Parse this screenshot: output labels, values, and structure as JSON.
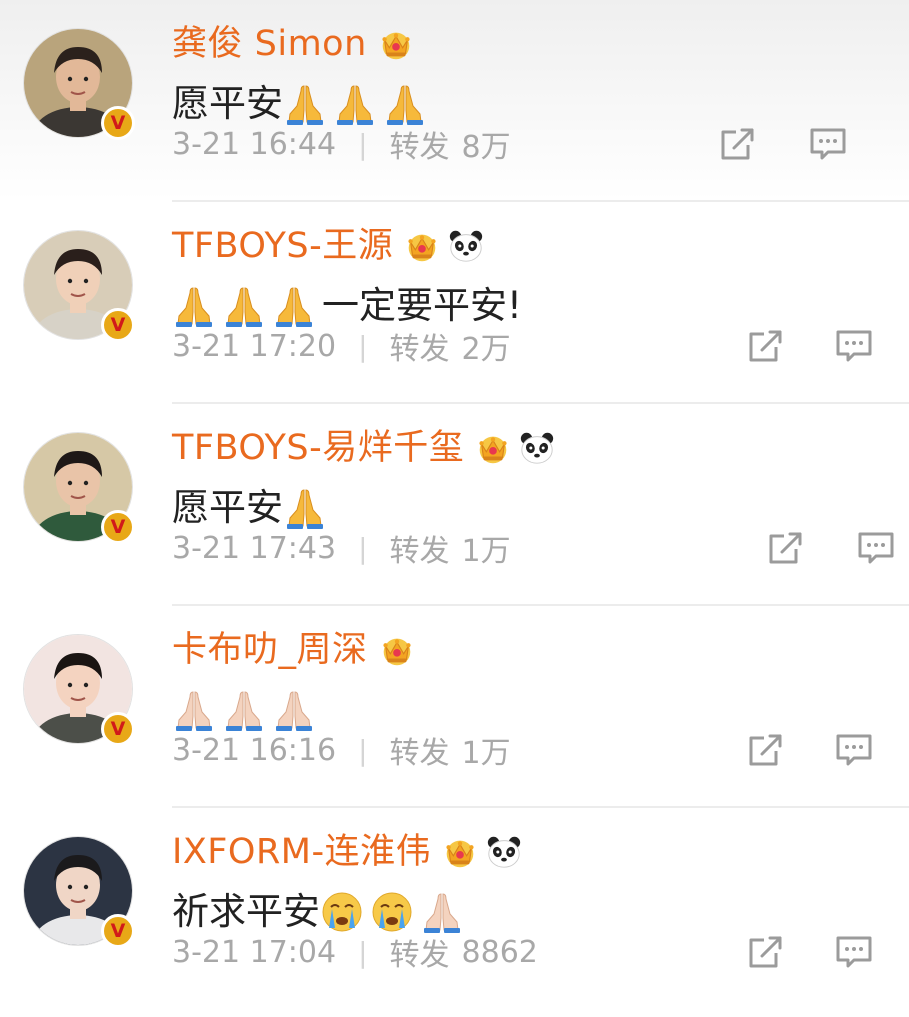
{
  "posts": [
    {
      "name": "龚俊 Simon",
      "badges": [
        "crown-icon"
      ],
      "content_text": "愿平安",
      "emoji_before": [],
      "emoji_after": [
        "folded-hands-icon",
        "folded-hands-icon",
        "folded-hands-icon"
      ],
      "time": "3-21 16:44",
      "repost_label": "转发",
      "repost_count": "8万"
    },
    {
      "name": "TFBOYS-王源",
      "badges": [
        "crown-icon",
        "panda-icon"
      ],
      "content_text": "一定要平安!",
      "emoji_before": [
        "folded-hands-icon",
        "folded-hands-icon",
        "folded-hands-icon"
      ],
      "emoji_after": [],
      "time": "3-21 17:20",
      "repost_label": "转发",
      "repost_count": "2万"
    },
    {
      "name": "TFBOYS-易烊千玺",
      "badges": [
        "crown-icon",
        "panda-icon"
      ],
      "content_text": "愿平安",
      "emoji_before": [],
      "emoji_after": [
        "folded-hands-icon"
      ],
      "time": "3-21 17:43",
      "repost_label": "转发",
      "repost_count": "1万"
    },
    {
      "name": "卡布叻_周深",
      "badges": [
        "crown-icon"
      ],
      "content_text": "",
      "emoji_before": [
        "folded-hands-light-icon",
        "folded-hands-light-icon",
        "folded-hands-light-icon"
      ],
      "emoji_after": [],
      "time": "3-21 16:16",
      "repost_label": "转发",
      "repost_count": "1万"
    },
    {
      "name": "IXFORM-连淮伟",
      "badges": [
        "crown-icon",
        "panda-icon"
      ],
      "content_text": "祈求平安",
      "emoji_before": [],
      "emoji_after": [
        "crying-face-icon",
        "crying-face-icon",
        "folded-hands-light-icon"
      ],
      "time": "3-21 17:04",
      "repost_label": "转发",
      "repost_count": "8862"
    }
  ],
  "colors": {
    "name": "#e96a1f",
    "text": "#222222",
    "meta": "#a8a8a8",
    "badge_bg": "#e8a817",
    "badge_v": "#d11a1a",
    "divider": "#ececec"
  }
}
